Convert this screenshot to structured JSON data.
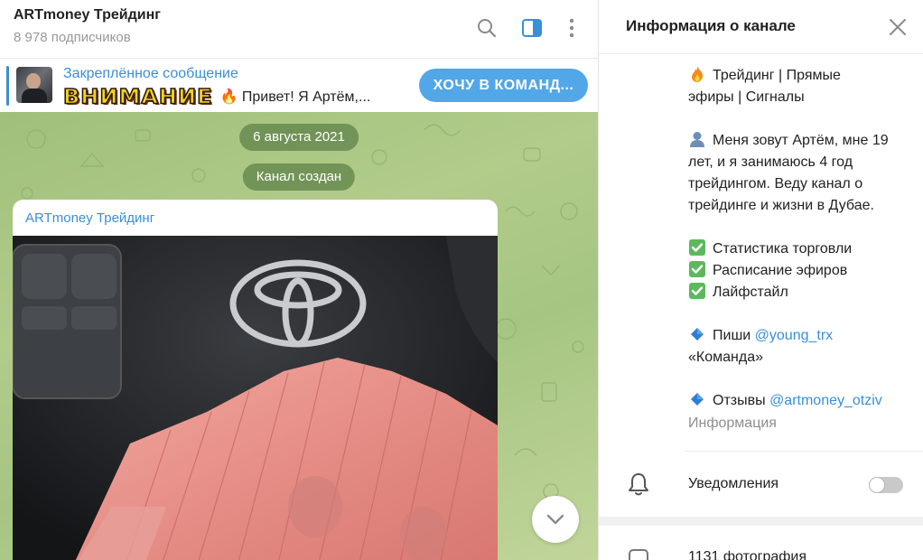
{
  "chat": {
    "title": "ARTmoney Трейдинг",
    "subscribers": "8 978 подписчиков"
  },
  "header_icons": [
    "search-icon",
    "sidebar-toggle-icon",
    "more-vertical-icon"
  ],
  "pinned": {
    "title": "Закреплённое сообщение",
    "banner_word": "ВНИМАНИЕ",
    "text": "🔥 Привет! Я Артём,...",
    "button_label": "ХОЧУ В КОМАНД..."
  },
  "feed": {
    "date_pill": "6 августа 2021",
    "service_pill": "Канал создан",
    "message_author": "ARTmoney Трейдинг"
  },
  "info_panel": {
    "title": "Информация о канале",
    "about": {
      "line1": "Трейдинг | Прямые",
      "line2": "эфиры | Сигналы",
      "line3": "Меня зовут Артём, мне 19",
      "line4": "лет, и я занимаюсь 4 год",
      "line5": "трейдингом. Веду канал о",
      "line6": "трейдинге и жизни в Дубае.",
      "line7": "Статистика торговли",
      "line8": "Расписание эфиров",
      "line9": "Лайфстайл",
      "line10_prefix": "Пиши ",
      "line10_link": "@young_trx",
      "line11": "«Команда»",
      "line12_prefix": "Отзывы ",
      "line12_link": "@artmoney_otziv"
    },
    "about_label": "Информация",
    "notifications_label": "Уведомления",
    "notifications_enabled": false,
    "photos_label": "1131 фотография"
  },
  "colors": {
    "accent": "#3a8fd6",
    "button": "#52a7e8",
    "chat_bg": "#a6c582",
    "pill": "#5c8046"
  }
}
